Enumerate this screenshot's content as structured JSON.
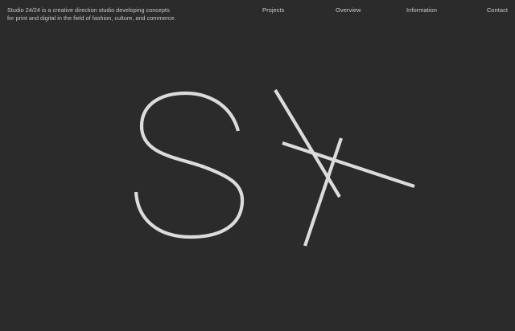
{
  "tagline": {
    "line1": "Studio 24/24 is a creative direction studio developing concepts",
    "line2": "for print and digital in the field of fashion, culture, and commerce."
  },
  "nav": {
    "projects": "Projects",
    "overview": "Overview",
    "information": "Information",
    "contact": "Contact"
  },
  "colors": {
    "background": "#2b2b2b",
    "text": "#c9c9c9",
    "logo_stroke": "#dcdcdc"
  },
  "logo": {
    "icon": "s-cross-monogram-icon"
  }
}
